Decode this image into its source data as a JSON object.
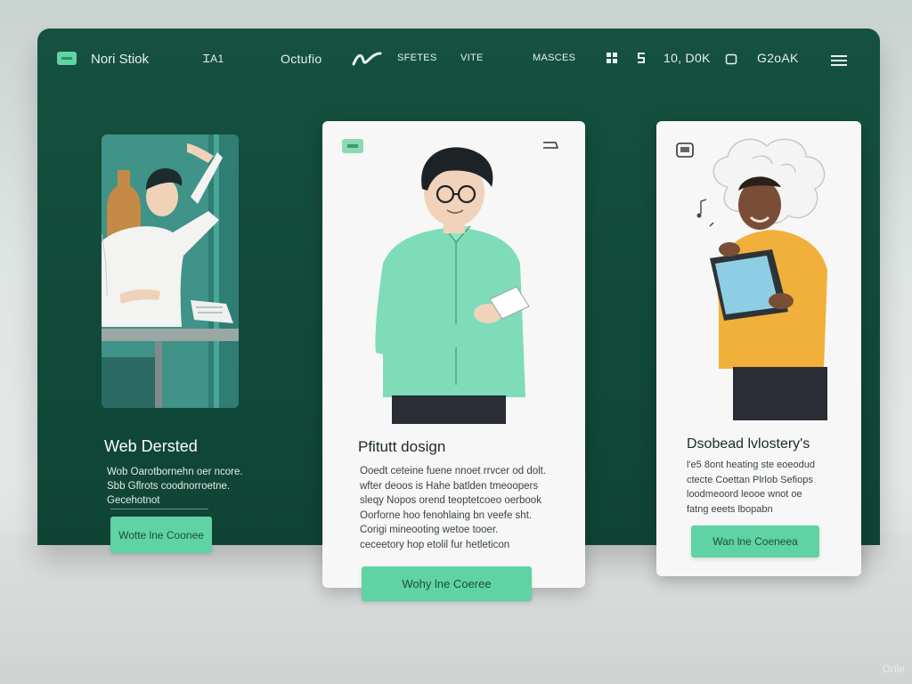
{
  "nav": {
    "brand": "Nori Stiok",
    "items": [
      "ᏆA1",
      "Octufio",
      "SFETES",
      "VITE",
      "MASCES",
      "10, D0K",
      "G2oAK"
    ],
    "icons": [
      "logo-badge",
      "squiggle-mark",
      "grid-icon",
      "s-icon",
      "square-icon",
      "hamburger-menu-icon"
    ]
  },
  "cards": {
    "left": {
      "title": "Web Dersted",
      "body": "Wob Oarotbornehn oer ncore.\nSbb Gflrots coodnorroetne.\nGecehotnot",
      "button": "Wotte lne Coonee"
    },
    "center": {
      "title": "Pfitutt dosign",
      "body": "Ooedt ceteine fuene nnoet rrvcer od dolt.\nwfter deoos is Hahe batlden tmeoopers\nsleqy Nopos orend teoptetcoeo oerbook\nOorforne hoo fenohlaing bn veefe sht.\nCorigi mineooting wetoe tooer.\nceceetory hop etolil fur hetleticon",
      "button": "Wohy lne Coeree"
    },
    "right": {
      "title": "Dsobead lvlostery's",
      "body": "l'e5 8ont heating ste eoeodud\nctecte Coettan Plrlob Sefiops\nloodmeoord leooe wnot oe\nfatng eeets lbopabn",
      "button": "Wan lne Coeneea"
    }
  },
  "watermark": "Orile",
  "colors": {
    "panel": "#155140",
    "accent": "#5fd3a3",
    "card_bg": "#f6f7f6"
  }
}
